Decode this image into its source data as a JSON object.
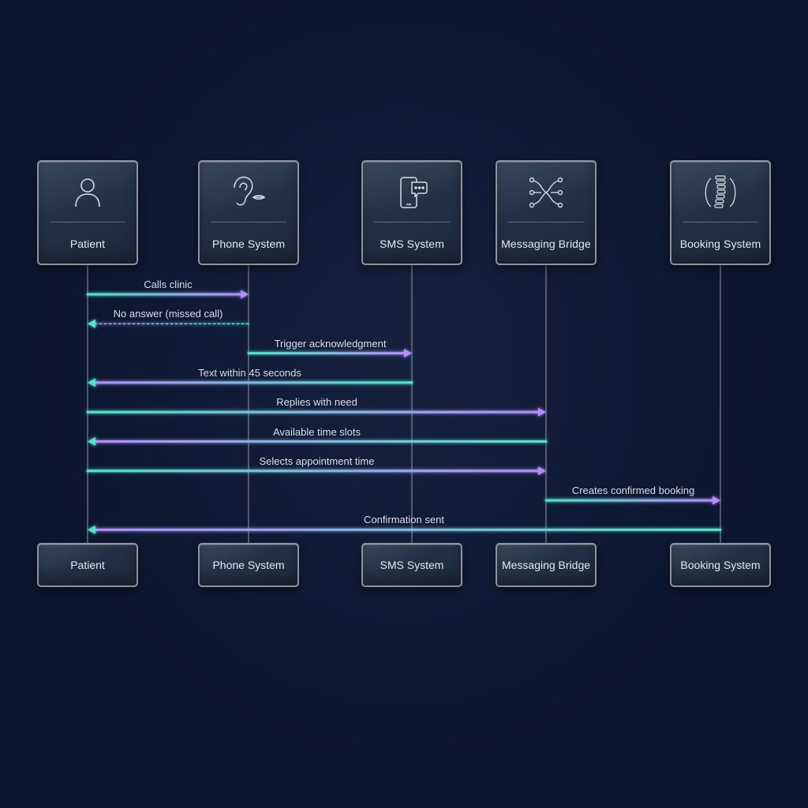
{
  "participants": [
    {
      "label": "Patient",
      "icon": "person-icon"
    },
    {
      "label": "Phone System",
      "icon": "ear-mouth-icon"
    },
    {
      "label": "SMS System",
      "icon": "phone-chat-icon"
    },
    {
      "label": "Messaging Bridge",
      "icon": "network-nodes-icon"
    },
    {
      "label": "Booking System",
      "icon": "spine-icon"
    }
  ],
  "messages": [
    {
      "label": "Calls clinic",
      "from": 0,
      "to": 1,
      "style": "solid"
    },
    {
      "label": "No answer (missed call)",
      "from": 1,
      "to": 0,
      "style": "dashed"
    },
    {
      "label": "Trigger acknowledgment",
      "from": 1,
      "to": 2,
      "style": "solid"
    },
    {
      "label": "Text within 45 seconds",
      "from": 2,
      "to": 0,
      "style": "solid"
    },
    {
      "label": "Replies with need",
      "from": 0,
      "to": 3,
      "style": "solid"
    },
    {
      "label": "Available time slots",
      "from": 3,
      "to": 0,
      "style": "solid"
    },
    {
      "label": "Selects appointment time",
      "from": 0,
      "to": 3,
      "style": "solid"
    },
    {
      "label": "Creates confirmed booking",
      "from": 3,
      "to": 4,
      "style": "solid"
    },
    {
      "label": "Confirmation sent",
      "from": 4,
      "to": 0,
      "style": "solid"
    }
  ],
  "colors": {
    "background": "#0b1630",
    "arrow_teal": "#4ee6c4",
    "arrow_violet": "#b48cff",
    "lifeline": "#7d858f"
  }
}
